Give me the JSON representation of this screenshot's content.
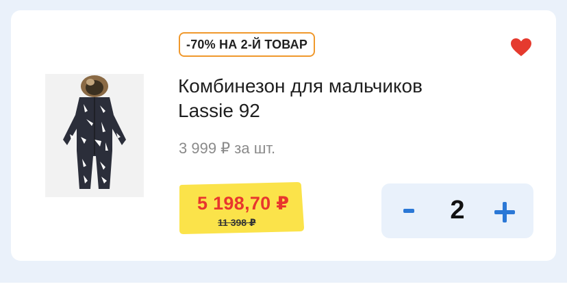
{
  "product": {
    "promo_badge": "-70% НА 2-Й ТОВАР",
    "title": "Комбинезон для мальчиков Lassie 92",
    "unit_price": "3 999 ₽ за шт.",
    "price_current": "5 198,70 ₽",
    "price_old": "11 398 ₽",
    "favorite_icon": "heart-icon",
    "image_icon": "snowsuit-image"
  },
  "quantity": {
    "value": "2",
    "minus_icon": "minus-icon",
    "plus_icon": "plus-icon"
  },
  "colors": {
    "badge_border": "#f0982b",
    "heart": "#e53a2e",
    "price_red": "#e8362d",
    "price_tag_yellow": "#fbe34a",
    "qty_bg": "#e9f1fb",
    "qty_accent": "#2b78d6",
    "page_bg": "#eaf1fa"
  }
}
